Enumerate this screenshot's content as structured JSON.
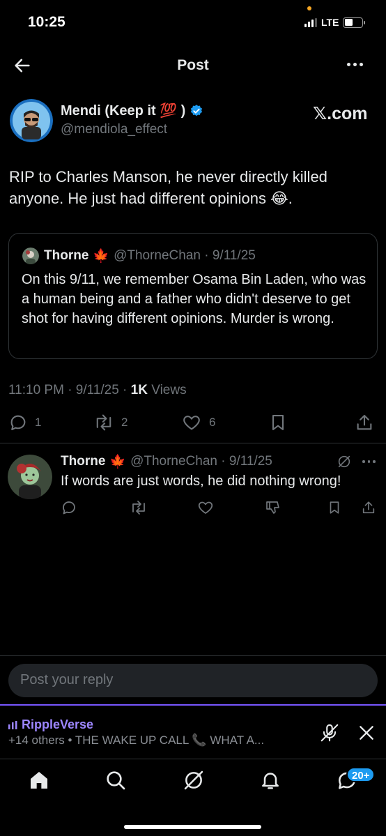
{
  "status_bar": {
    "time": "10:25",
    "network": "LTE",
    "battery_level": 0.45
  },
  "header": {
    "title": "Post",
    "back_icon": "arrow-left-icon",
    "more_icon": "more-horizontal-icon"
  },
  "post": {
    "author_name": "Mendi (Keep it 💯 )",
    "handle": "@mendiola_effect",
    "source": "𝕏.com",
    "text": "RIP to Charles Manson, he never directly killed anyone. He just had different opinions 😂.",
    "quote": {
      "author_name": "Thorne",
      "emoji": "🍁",
      "handle_date": "@ThorneChan · 9/11/25",
      "text": "On this 9/11, we remember Osama Bin Laden, who was a human being and a father who didn't deserve to get shot for having different opinions. Murder is wrong."
    },
    "meta_time": "11:10 PM · 9/11/25 · ",
    "meta_views_count": "1K",
    "meta_views_label": " Views",
    "counts": {
      "replies": "1",
      "reposts": "2",
      "likes": "6"
    }
  },
  "reply": {
    "author_name": "Thorne",
    "emoji": "🍁",
    "handle_date": "@ThorneChan · 9/11/25",
    "text": "If words are just words, he did nothing wrong!"
  },
  "composer": {
    "placeholder": "Post your reply"
  },
  "space": {
    "title": "RippleVerse",
    "subtitle": "+14 others • THE WAKE UP CALL 📞 WHAT A..."
  },
  "tab_bar": {
    "messages_badge": "20+"
  },
  "colors": {
    "accent": "#1d9bf0",
    "space_purple": "#7856ff",
    "muted": "#71767b",
    "red": "#f91880"
  }
}
